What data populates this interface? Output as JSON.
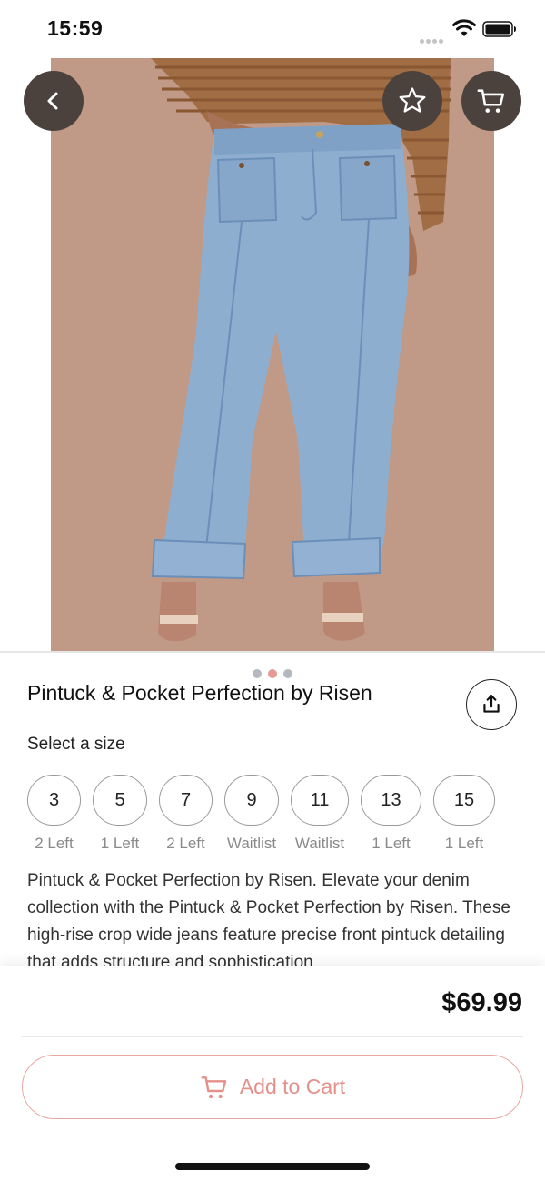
{
  "status_bar": {
    "time": "15:59",
    "icons": [
      "signal-dots-icon",
      "wifi-icon",
      "battery-icon"
    ]
  },
  "hero": {
    "pager": {
      "count": 3,
      "active_index": 1
    },
    "buttons": {
      "back": "chevron-left-icon",
      "favorite": "star-icon",
      "cart": "cart-icon"
    }
  },
  "product": {
    "title": "Pintuck & Pocket Perfection by Risen",
    "share_icon": "share-icon",
    "size_label": "Select a size",
    "sizes": [
      {
        "size": "3",
        "availability": "2 Left"
      },
      {
        "size": "5",
        "availability": "1 Left"
      },
      {
        "size": "7",
        "availability": "2 Left"
      },
      {
        "size": "9",
        "availability": "Waitlist"
      },
      {
        "size": "11",
        "availability": "Waitlist"
      },
      {
        "size": "13",
        "availability": "1 Left"
      },
      {
        "size": "15",
        "availability": "1 Left"
      }
    ],
    "description": "Pintuck & Pocket Perfection by Risen. Elevate your denim collection with the Pintuck & Pocket Perfection by Risen. These high-rise crop wide jeans feature precise front pintuck detailing that adds structure and sophistication"
  },
  "footer": {
    "price": "$69.99",
    "add_to_cart_label": "Add to Cart"
  },
  "colors": {
    "accent": "#e3918a",
    "hero_bg": "#c09a86",
    "overlay_button": "#4b423e",
    "denim": "#8eaed0"
  }
}
